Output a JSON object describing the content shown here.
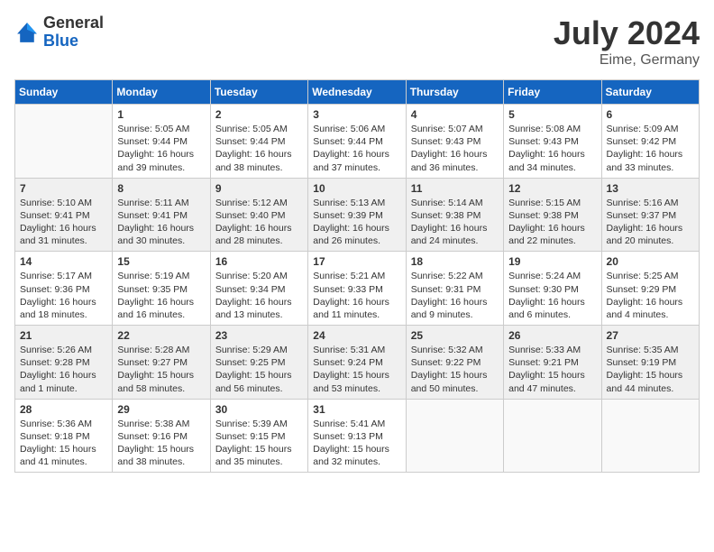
{
  "header": {
    "logo_general": "General",
    "logo_blue": "Blue",
    "month_year": "July 2024",
    "location": "Eime, Germany"
  },
  "days_of_week": [
    "Sunday",
    "Monday",
    "Tuesday",
    "Wednesday",
    "Thursday",
    "Friday",
    "Saturday"
  ],
  "weeks": [
    [
      {
        "day": "",
        "sunrise": "",
        "sunset": "",
        "daylight": ""
      },
      {
        "day": "1",
        "sunrise": "Sunrise: 5:05 AM",
        "sunset": "Sunset: 9:44 PM",
        "daylight": "Daylight: 16 hours and 39 minutes."
      },
      {
        "day": "2",
        "sunrise": "Sunrise: 5:05 AM",
        "sunset": "Sunset: 9:44 PM",
        "daylight": "Daylight: 16 hours and 38 minutes."
      },
      {
        "day": "3",
        "sunrise": "Sunrise: 5:06 AM",
        "sunset": "Sunset: 9:44 PM",
        "daylight": "Daylight: 16 hours and 37 minutes."
      },
      {
        "day": "4",
        "sunrise": "Sunrise: 5:07 AM",
        "sunset": "Sunset: 9:43 PM",
        "daylight": "Daylight: 16 hours and 36 minutes."
      },
      {
        "day": "5",
        "sunrise": "Sunrise: 5:08 AM",
        "sunset": "Sunset: 9:43 PM",
        "daylight": "Daylight: 16 hours and 34 minutes."
      },
      {
        "day": "6",
        "sunrise": "Sunrise: 5:09 AM",
        "sunset": "Sunset: 9:42 PM",
        "daylight": "Daylight: 16 hours and 33 minutes."
      }
    ],
    [
      {
        "day": "7",
        "sunrise": "Sunrise: 5:10 AM",
        "sunset": "Sunset: 9:41 PM",
        "daylight": "Daylight: 16 hours and 31 minutes."
      },
      {
        "day": "8",
        "sunrise": "Sunrise: 5:11 AM",
        "sunset": "Sunset: 9:41 PM",
        "daylight": "Daylight: 16 hours and 30 minutes."
      },
      {
        "day": "9",
        "sunrise": "Sunrise: 5:12 AM",
        "sunset": "Sunset: 9:40 PM",
        "daylight": "Daylight: 16 hours and 28 minutes."
      },
      {
        "day": "10",
        "sunrise": "Sunrise: 5:13 AM",
        "sunset": "Sunset: 9:39 PM",
        "daylight": "Daylight: 16 hours and 26 minutes."
      },
      {
        "day": "11",
        "sunrise": "Sunrise: 5:14 AM",
        "sunset": "Sunset: 9:38 PM",
        "daylight": "Daylight: 16 hours and 24 minutes."
      },
      {
        "day": "12",
        "sunrise": "Sunrise: 5:15 AM",
        "sunset": "Sunset: 9:38 PM",
        "daylight": "Daylight: 16 hours and 22 minutes."
      },
      {
        "day": "13",
        "sunrise": "Sunrise: 5:16 AM",
        "sunset": "Sunset: 9:37 PM",
        "daylight": "Daylight: 16 hours and 20 minutes."
      }
    ],
    [
      {
        "day": "14",
        "sunrise": "Sunrise: 5:17 AM",
        "sunset": "Sunset: 9:36 PM",
        "daylight": "Daylight: 16 hours and 18 minutes."
      },
      {
        "day": "15",
        "sunrise": "Sunrise: 5:19 AM",
        "sunset": "Sunset: 9:35 PM",
        "daylight": "Daylight: 16 hours and 16 minutes."
      },
      {
        "day": "16",
        "sunrise": "Sunrise: 5:20 AM",
        "sunset": "Sunset: 9:34 PM",
        "daylight": "Daylight: 16 hours and 13 minutes."
      },
      {
        "day": "17",
        "sunrise": "Sunrise: 5:21 AM",
        "sunset": "Sunset: 9:33 PM",
        "daylight": "Daylight: 16 hours and 11 minutes."
      },
      {
        "day": "18",
        "sunrise": "Sunrise: 5:22 AM",
        "sunset": "Sunset: 9:31 PM",
        "daylight": "Daylight: 16 hours and 9 minutes."
      },
      {
        "day": "19",
        "sunrise": "Sunrise: 5:24 AM",
        "sunset": "Sunset: 9:30 PM",
        "daylight": "Daylight: 16 hours and 6 minutes."
      },
      {
        "day": "20",
        "sunrise": "Sunrise: 5:25 AM",
        "sunset": "Sunset: 9:29 PM",
        "daylight": "Daylight: 16 hours and 4 minutes."
      }
    ],
    [
      {
        "day": "21",
        "sunrise": "Sunrise: 5:26 AM",
        "sunset": "Sunset: 9:28 PM",
        "daylight": "Daylight: 16 hours and 1 minute."
      },
      {
        "day": "22",
        "sunrise": "Sunrise: 5:28 AM",
        "sunset": "Sunset: 9:27 PM",
        "daylight": "Daylight: 15 hours and 58 minutes."
      },
      {
        "day": "23",
        "sunrise": "Sunrise: 5:29 AM",
        "sunset": "Sunset: 9:25 PM",
        "daylight": "Daylight: 15 hours and 56 minutes."
      },
      {
        "day": "24",
        "sunrise": "Sunrise: 5:31 AM",
        "sunset": "Sunset: 9:24 PM",
        "daylight": "Daylight: 15 hours and 53 minutes."
      },
      {
        "day": "25",
        "sunrise": "Sunrise: 5:32 AM",
        "sunset": "Sunset: 9:22 PM",
        "daylight": "Daylight: 15 hours and 50 minutes."
      },
      {
        "day": "26",
        "sunrise": "Sunrise: 5:33 AM",
        "sunset": "Sunset: 9:21 PM",
        "daylight": "Daylight: 15 hours and 47 minutes."
      },
      {
        "day": "27",
        "sunrise": "Sunrise: 5:35 AM",
        "sunset": "Sunset: 9:19 PM",
        "daylight": "Daylight: 15 hours and 44 minutes."
      }
    ],
    [
      {
        "day": "28",
        "sunrise": "Sunrise: 5:36 AM",
        "sunset": "Sunset: 9:18 PM",
        "daylight": "Daylight: 15 hours and 41 minutes."
      },
      {
        "day": "29",
        "sunrise": "Sunrise: 5:38 AM",
        "sunset": "Sunset: 9:16 PM",
        "daylight": "Daylight: 15 hours and 38 minutes."
      },
      {
        "day": "30",
        "sunrise": "Sunrise: 5:39 AM",
        "sunset": "Sunset: 9:15 PM",
        "daylight": "Daylight: 15 hours and 35 minutes."
      },
      {
        "day": "31",
        "sunrise": "Sunrise: 5:41 AM",
        "sunset": "Sunset: 9:13 PM",
        "daylight": "Daylight: 15 hours and 32 minutes."
      },
      {
        "day": "",
        "sunrise": "",
        "sunset": "",
        "daylight": ""
      },
      {
        "day": "",
        "sunrise": "",
        "sunset": "",
        "daylight": ""
      },
      {
        "day": "",
        "sunrise": "",
        "sunset": "",
        "daylight": ""
      }
    ]
  ]
}
